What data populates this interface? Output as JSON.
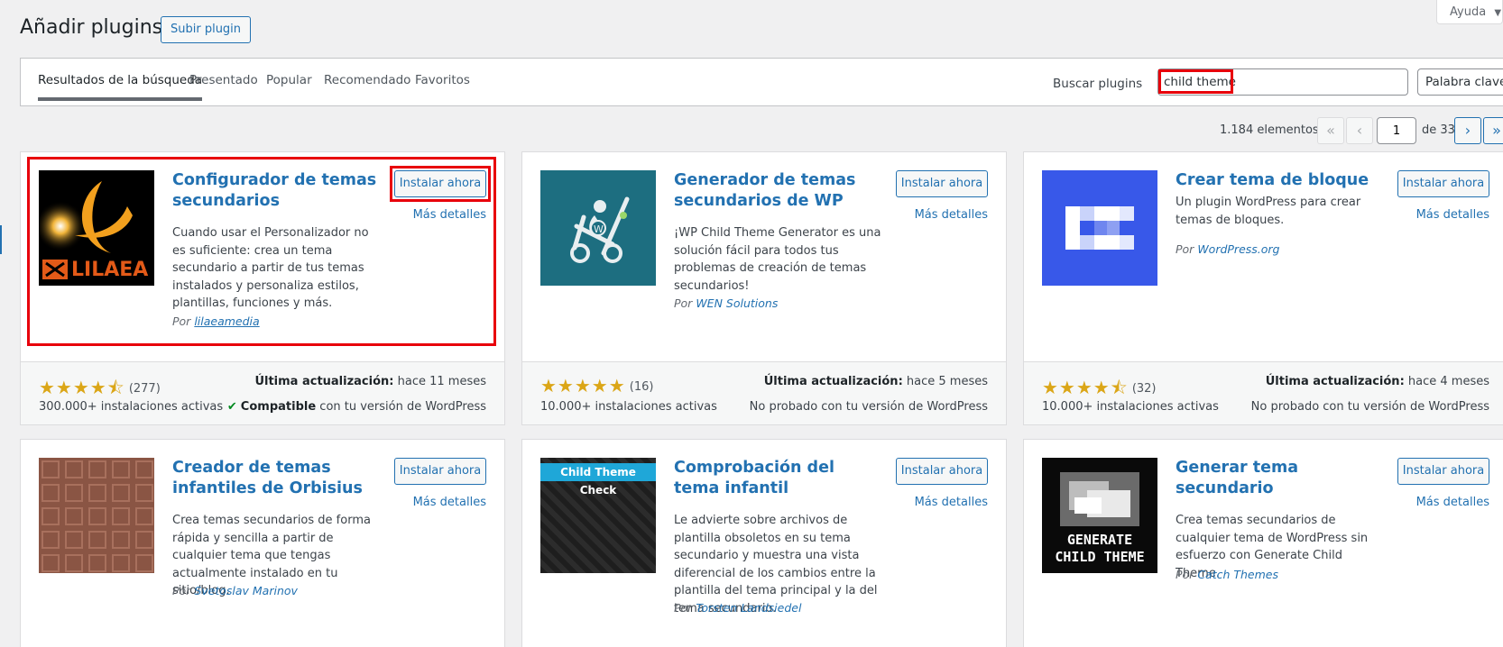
{
  "header": {
    "help_label": "Ayuda",
    "help_caret": "▼",
    "title": "Añadir plugins",
    "upload_label": "Subir plugin"
  },
  "tabs": [
    {
      "label": "Resultados de la búsqueda",
      "active": true
    },
    {
      "label": "Presentado",
      "active": false
    },
    {
      "label": "Popular",
      "active": false
    },
    {
      "label": "Recomendado",
      "active": false
    },
    {
      "label": "Favoritos",
      "active": false
    }
  ],
  "search": {
    "label": "Buscar plugins",
    "value": "child theme",
    "type_selected": "Palabra clave"
  },
  "pagination": {
    "items": "1.184 elementos",
    "first": "«",
    "prev": "‹",
    "current_page": "1",
    "of_text": "de 33",
    "next": "›",
    "last": "»"
  },
  "plugins": [
    {
      "name": "Configurador de temas secundarios",
      "description": "Cuando usar el Personalizador no es suficiente: crea un tema secundario a partir de tus temas instalados y personaliza estilos, plantillas, funciones y más.",
      "author_prefix": "Por",
      "author": "lilaeamedia",
      "install_label": "Instalar ahora",
      "details_label": "Más detalles",
      "stars": "★★★★⯪",
      "rating_count": "(277)",
      "last_updated_label": "Última actualización:",
      "last_updated": "hace 11 meses",
      "installs": "300.000+ instalaciones activas",
      "compat_strong": "Compatible",
      "compat_text": "con tu versión de WordPress",
      "compat_check": "✔",
      "logo_text": "LILAEA"
    },
    {
      "name": "Generador de temas secundarios de WP",
      "description": "¡WP Child Theme Generator es una solución fácil para todos tus problemas de creación de temas secundarios!",
      "author_prefix": "Por",
      "author": "WEN Solutions",
      "install_label": "Instalar ahora",
      "details_label": "Más detalles",
      "stars": "★★★★★",
      "rating_count": "(16)",
      "last_updated_label": "Última actualización:",
      "last_updated": "hace 5 meses",
      "installs": "10.000+ instalaciones activas",
      "compat_text": "No probado con tu versión de WordPress"
    },
    {
      "name": "Crear tema de bloque",
      "description": "Un plugin WordPress para crear temas de bloques.",
      "author_prefix": "Por",
      "author": "WordPress.org",
      "install_label": "Instalar ahora",
      "details_label": "Más detalles",
      "stars": "★★★★⯪",
      "rating_count": "(32)",
      "last_updated_label": "Última actualización:",
      "last_updated": "hace 4 meses",
      "installs": "10.000+ instalaciones activas",
      "compat_text": "No probado con tu versión de WordPress"
    },
    {
      "name": "Creador de temas infantiles de Orbisius",
      "description": "Crea temas secundarios de forma rápida y sencilla a partir de cualquier tema que tengas actualmente instalado en tu sitio/blog.",
      "author_prefix": "Por",
      "author": "Svetoslav Marinov",
      "install_label": "Instalar ahora",
      "details_label": "Más detalles"
    },
    {
      "name": "Comprobación del tema infantil",
      "description": "Le advierte sobre archivos de plantilla obsoletos en su tema secundario y muestra una vista diferencial de los cambios entre la plantilla del tema principal y la del tema secundario.",
      "author_prefix": "Por",
      "author": "Torsten Landsiedel",
      "install_label": "Instalar ahora",
      "details_label": "Más detalles",
      "logo_text": "Child Theme Check"
    },
    {
      "name": "Generar tema secundario",
      "description": "Crea temas secundarios de cualquier tema de WordPress sin esfuerzo con Generate Child Theme.",
      "author_prefix": "Por",
      "author": "Catch Themes",
      "install_label": "Instalar ahora",
      "details_label": "Más detalles",
      "logo_line1": "GENERATE",
      "logo_line2": "CHILD THEME"
    }
  ],
  "colors": {
    "accent": "#2271b1",
    "highlight": "#e8000b",
    "star": "#dba617",
    "thumb_wen": "#1d6e80",
    "thumb_block": "#3858e9",
    "thumb_orbisius": "#8a5544"
  }
}
